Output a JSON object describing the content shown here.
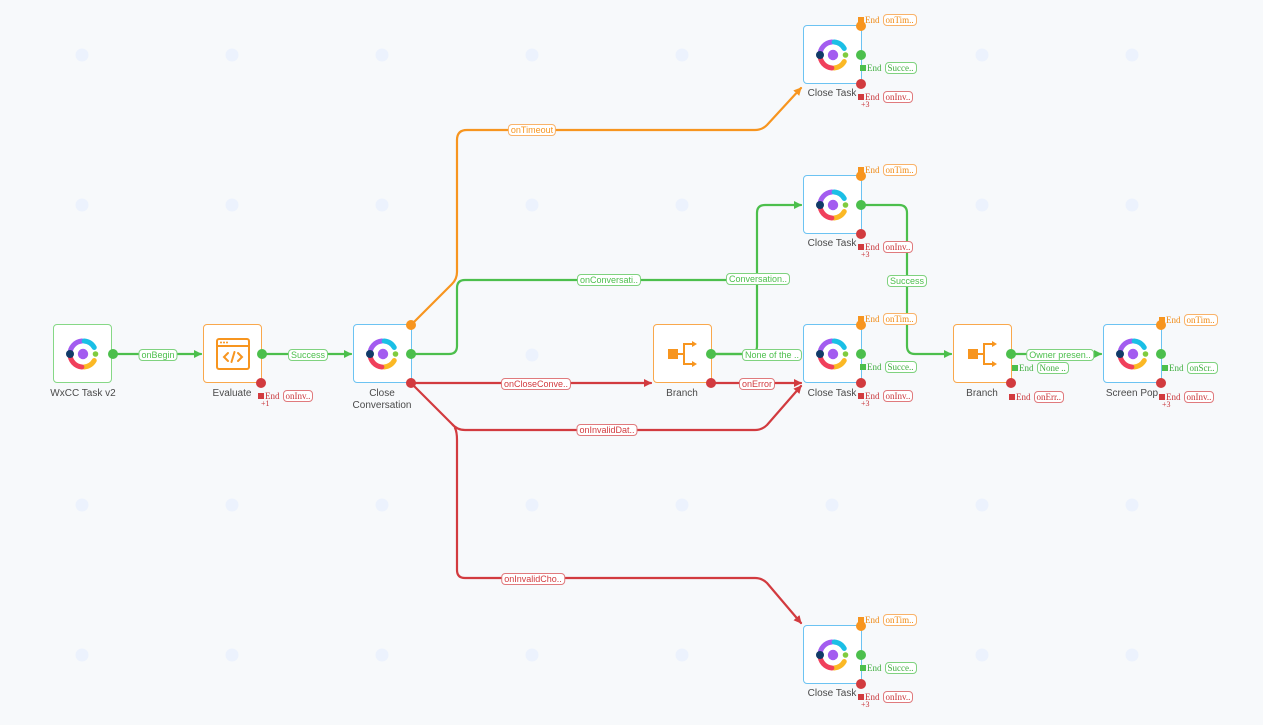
{
  "canvas": {
    "colors": {
      "success": "#4cbf4c",
      "timeout": "#f7951f",
      "error": "#d23b3f",
      "activity_border": "#6cc3f2",
      "logic_border": "#f9a84c",
      "start_border": "#86d886",
      "background": "#f7f9fb"
    }
  },
  "nodes": {
    "wxcc_task": {
      "label": "WxCC Task v2",
      "icon": "webex-contact-center-logo-icon"
    },
    "evaluate": {
      "label": "Evaluate",
      "icon": "code-window-icon",
      "ends": {
        "error": {
          "word": "End",
          "tag": "onInv..",
          "more": "+1"
        }
      }
    },
    "close_conversation": {
      "label_line1": "Close",
      "label_line2": "Conversation",
      "icon": "webex-contact-center-logo-icon"
    },
    "branch_1": {
      "label": "Branch",
      "icon": "branch-icon"
    },
    "close_task_top": {
      "label": "Close Task",
      "icon": "webex-contact-center-logo-icon",
      "ends": {
        "timeout": {
          "word": "End",
          "tag": "onTim.."
        },
        "success": {
          "word": "End",
          "tag": "Succe.."
        },
        "error": {
          "word": "End",
          "tag": "onInv..",
          "more": "+3"
        }
      }
    },
    "close_task_upper": {
      "label": "Close Task",
      "icon": "webex-contact-center-logo-icon",
      "ends": {
        "timeout": {
          "word": "End",
          "tag": "onTim.."
        },
        "error": {
          "word": "End",
          "tag": "onInv..",
          "more": "+3"
        }
      }
    },
    "close_task_middle": {
      "label": "Close Task",
      "icon": "webex-contact-center-logo-icon",
      "ends": {
        "timeout": {
          "word": "End",
          "tag": "onTim.."
        },
        "success": {
          "word": "End",
          "tag": "Succe.."
        },
        "error": {
          "word": "End",
          "tag": "onInv..",
          "more": "+3"
        }
      }
    },
    "close_task_bottom": {
      "label": "Close Task",
      "icon": "webex-contact-center-logo-icon",
      "ends": {
        "timeout": {
          "word": "End",
          "tag": "onTim.."
        },
        "success": {
          "word": "End",
          "tag": "Succe.."
        },
        "error": {
          "word": "End",
          "tag": "onInv..",
          "more": "+3"
        }
      }
    },
    "branch_2": {
      "label": "Branch",
      "icon": "branch-icon",
      "ends": {
        "success": {
          "word": "End",
          "tag": "None .."
        },
        "error": {
          "word": "End",
          "tag": "onErr.."
        }
      }
    },
    "screen_pop": {
      "label": "Screen Pop",
      "icon": "webex-contact-center-logo-icon",
      "ends": {
        "timeout": {
          "word": "End",
          "tag": "onTim.."
        },
        "success": {
          "word": "End",
          "tag": "onScr.."
        },
        "error": {
          "word": "End",
          "tag": "onInv..",
          "more": "+3"
        }
      }
    }
  },
  "edges": {
    "on_begin": {
      "label": "onBegin",
      "from": "WxCC Task v2",
      "to": "Evaluate"
    },
    "evaluate_success": {
      "label": "Success",
      "from": "Evaluate",
      "to": "Close Conversation"
    },
    "on_timeout": {
      "label": "onTimeout",
      "from": "Close Conversation",
      "to": "Close Task"
    },
    "on_conversation": {
      "label": "onConversati..",
      "from": "Close Conversation",
      "to": "Close Task"
    },
    "branch_conversation": {
      "label": "Conversation..",
      "from": "Branch",
      "to": "Close Task"
    },
    "branch_none": {
      "label": "None of the ..",
      "from": "Branch",
      "to": "Close Task"
    },
    "on_close_conversation": {
      "label": "onCloseConve..",
      "from": "Close Conversation",
      "to": "Branch"
    },
    "branch_on_error": {
      "label": "onError",
      "from": "Branch",
      "to": "Close Task"
    },
    "on_invalid_data": {
      "label": "onInvalidDat..",
      "from": "Close Conversation",
      "to": "Close Task"
    },
    "on_invalid_choice": {
      "label": "onInvalidCho..",
      "from": "Close Conversation",
      "to": "Close Task"
    },
    "close_task_success": {
      "label": "Success",
      "from": "Close Task",
      "to": "Branch"
    },
    "owner_present": {
      "label": "Owner presen..",
      "from": "Branch",
      "to": "Screen Pop"
    }
  }
}
